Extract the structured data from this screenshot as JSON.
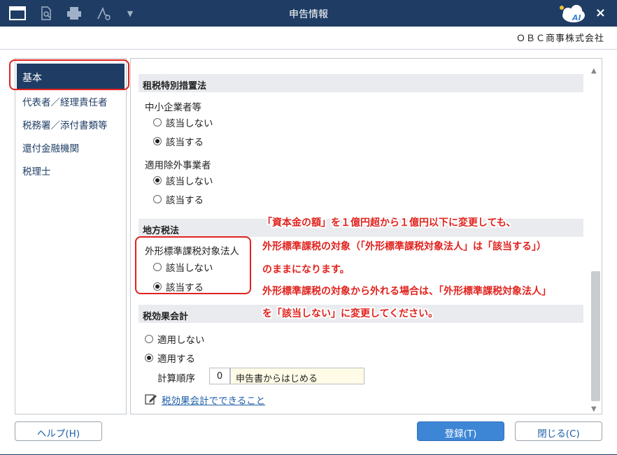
{
  "window": {
    "title": "申告情報",
    "company": "ＯＢＣ商事株式会社"
  },
  "titlebar": {
    "ai_label": "AI",
    "close_symbol": "×",
    "menu_arrow": "▼"
  },
  "nav": {
    "items": [
      {
        "label": "基本"
      },
      {
        "label": "代表者／経理責任者"
      },
      {
        "label": "税務署／添付書類等"
      },
      {
        "label": "還付金融機関"
      },
      {
        "label": "税理士"
      }
    ]
  },
  "sections": {
    "sozei": {
      "title": "租税特別措置法",
      "sme": {
        "label": "中小企業者等",
        "options": [
          "該当しない",
          "該当する"
        ],
        "selected": 1
      },
      "exclusion": {
        "label": "適用除外事業者",
        "options": [
          "該当しない",
          "該当する"
        ],
        "selected": 0
      }
    },
    "chiho": {
      "title": "地方税法",
      "gaikei": {
        "label": "外形標準課税対象法人",
        "options": [
          "該当しない",
          "該当する"
        ],
        "selected": 1
      }
    },
    "zeikouka": {
      "title": "税効果会計",
      "options": [
        "適用しない",
        "適用する"
      ],
      "selected": 1,
      "calc_label": "計算順序",
      "calc_number": "0",
      "calc_value": "申告書からはじめる",
      "link": "税効果会計でできること"
    }
  },
  "annotation": {
    "lines": [
      "「資本金の額」を１億円超から１億円以下に変更しても、",
      "外形標準課税の対象（「外形標準課税対象法人」は「該当する」）",
      "のままになります。",
      "外形標準課税の対象から外れる場合は、「外形標準課税対象法人」",
      "を「該当しない」に変更してください。"
    ]
  },
  "buttons": {
    "help": "ヘルプ(H)",
    "register": "登録(T)",
    "close": "閉じる(C)"
  },
  "colors": {
    "titlebar": "#1f3d64",
    "accent": "#3d86d6",
    "annotation": "#e0231e"
  }
}
